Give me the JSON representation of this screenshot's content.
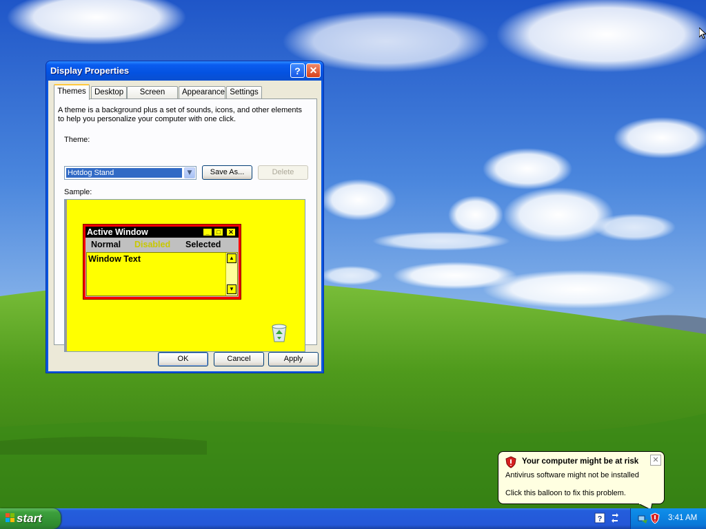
{
  "window": {
    "title": "Display Properties",
    "help_button": "?",
    "close_button": "✕",
    "tabs": [
      "Themes",
      "Desktop",
      "Screen Saver",
      "Appearance",
      "Settings"
    ],
    "active_tab": "Themes",
    "description": "A theme is a background plus a set of sounds, icons, and other elements to help you personalize your computer with one click.",
    "theme_label": "Theme:",
    "theme_value": "Hotdog Stand",
    "save_as_label": "Save As...",
    "delete_label": "Delete",
    "sample_label": "Sample:",
    "ok_label": "OK",
    "cancel_label": "Cancel",
    "apply_label": "Apply"
  },
  "sample": {
    "title": "Active Window",
    "menu_normal": "Normal",
    "menu_disabled": "Disabled",
    "menu_selected": "Selected",
    "window_text": "Window Text"
  },
  "taskbar": {
    "start_label": "start",
    "clock": "3:41 AM"
  },
  "balloon": {
    "title": "Your computer might be at risk",
    "line1": "Antivirus software might not be installed",
    "line2": "Click this balloon to fix this problem.",
    "close_button": "✕"
  },
  "colors": {
    "titlebar_blue": "#0a5cf0",
    "sample_yellow": "#ffff00",
    "sample_border_red": "#ff0000",
    "taskbar_blue": "#245edc",
    "start_green": "#3c9f3c",
    "balloon_bg": "#ffffe1"
  },
  "icons": [
    "help-icon",
    "close-icon",
    "recycle-bin-icon",
    "windows-flag-icon",
    "help-center-icon",
    "network-icon",
    "security-shield-icon",
    "mouse-cursor-icon"
  ]
}
